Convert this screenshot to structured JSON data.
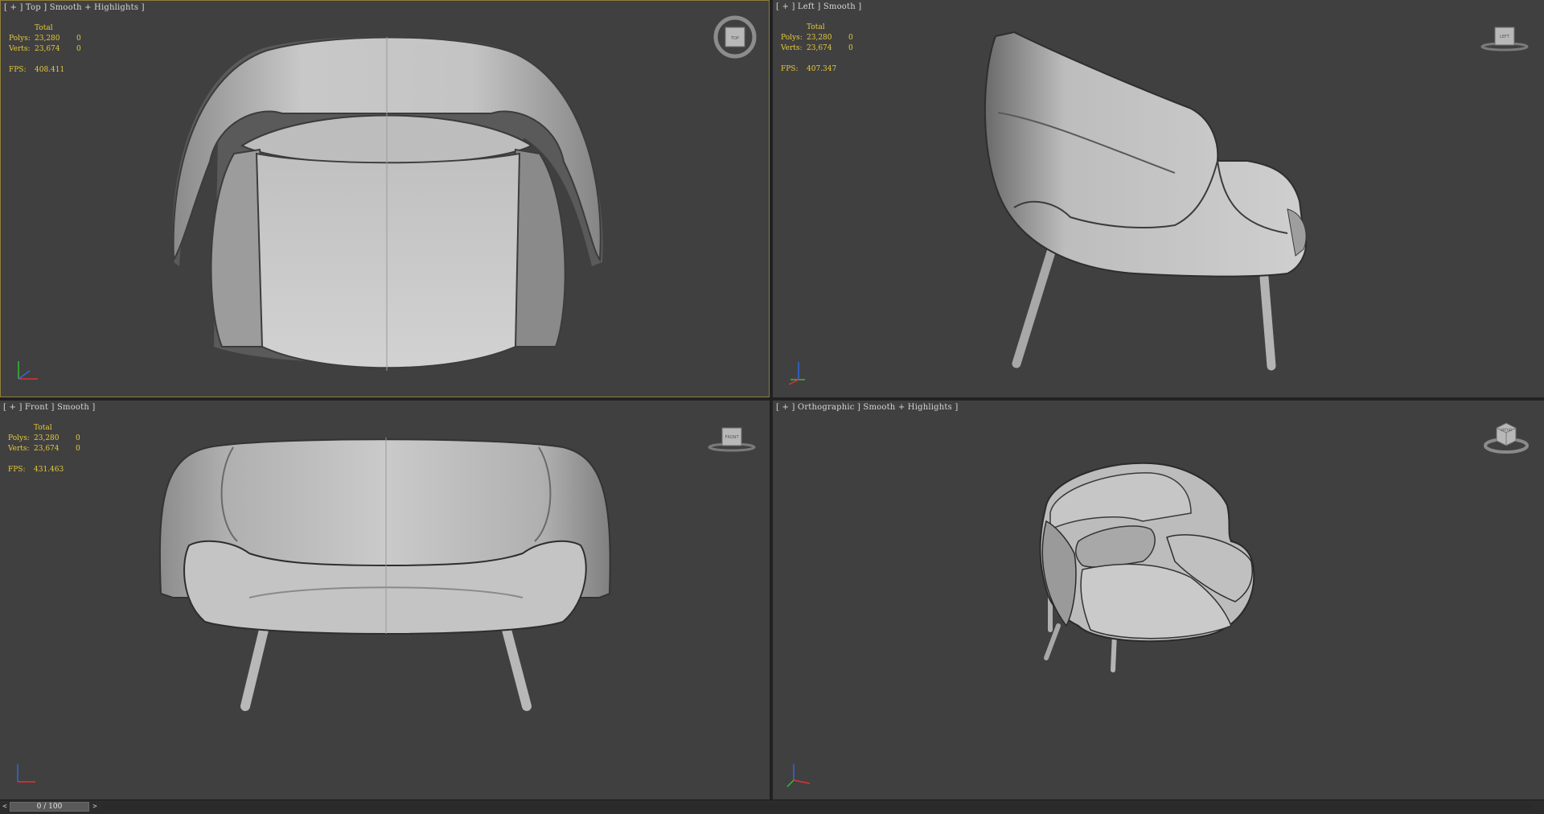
{
  "viewports": [
    {
      "id": "top",
      "label": "[ + ] Top ] Smooth + Highlights ]",
      "stats": {
        "header": "Total",
        "polys_label": "Polys:",
        "polys": "23,280",
        "polys_sel": "0",
        "verts_label": "Verts:",
        "verts": "23,674",
        "verts_sel": "0",
        "fps_label": "FPS:",
        "fps": "408.411"
      },
      "navcube": "TOP"
    },
    {
      "id": "left",
      "label": "[ + ] Left ] Smooth ]",
      "stats": {
        "header": "Total",
        "polys_label": "Polys:",
        "polys": "23,280",
        "polys_sel": "0",
        "verts_label": "Verts:",
        "verts": "23,674",
        "verts_sel": "0",
        "fps_label": "FPS:",
        "fps": "407.347"
      },
      "navcube": "LEFT"
    },
    {
      "id": "front",
      "label": "[ + ] Front ] Smooth ]",
      "stats": {
        "header": "Total",
        "polys_label": "Polys:",
        "polys": "23,280",
        "polys_sel": "0",
        "verts_label": "Verts:",
        "verts": "23,674",
        "verts_sel": "0",
        "fps_label": "FPS:",
        "fps": "431.463"
      },
      "navcube": "FRONT"
    },
    {
      "id": "ortho",
      "label": "[ + ] Orthographic ] Smooth + Highlights ]",
      "navcube": "ORTHO"
    }
  ],
  "timeline": {
    "prev": "<",
    "position": "0 / 100",
    "next": ">"
  },
  "colors": {
    "viewport_bg": "#404040",
    "stats": "#e6c93a",
    "active_border": "#8f7d3a",
    "model": "#b4b4b4"
  },
  "icons": {
    "nav": "view-cube-icon",
    "axis": "axis-tripod-icon"
  }
}
